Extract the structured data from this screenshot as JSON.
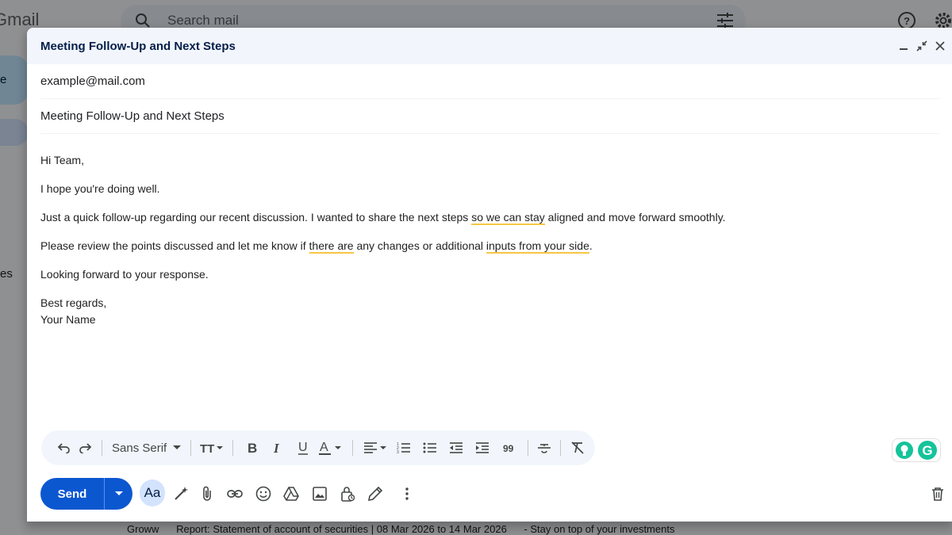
{
  "background": {
    "logo_text": "Gmail",
    "search_placeholder": "Search mail",
    "compose_letter": "e",
    "side_text": "es",
    "email_row": {
      "sender": "Groww",
      "subject": "Report: Statement of account of securities | 08 Mar 2026 to 14 Mar 2026",
      "snippet": "- Stay on top of your investments"
    }
  },
  "compose": {
    "title": "Meeting Follow-Up and Next Steps",
    "to_value": "example@mail.com",
    "subject_value": "Meeting Follow-Up and Next Steps",
    "body": {
      "greeting": "Hi Team,",
      "line1": "I hope you're doing well.",
      "line2_a": "Just a quick follow-up regarding our recent discussion. I wanted to share the next steps ",
      "line2_u": "so we can stay",
      "line2_b": " aligned and move forward smoothly.",
      "line3_a": "Please review the points discussed and let me know if ",
      "line3_u1": "there are",
      "line3_b": " any changes or additional ",
      "line3_u2": "inputs from your side",
      "line3_c": ".",
      "line4": "Looking forward to your response.",
      "signoff": "Best regards,",
      "name": "Your Name"
    },
    "toolbar": {
      "font_family": "Sans Serif"
    },
    "send_label": "Send",
    "aa_label": "Aa"
  },
  "colors": {
    "send_blue": "#0b57d0",
    "header_bg": "#f2f6fc",
    "grammarly_green": "#15c39a",
    "underline_yellow": "#f6c744"
  }
}
